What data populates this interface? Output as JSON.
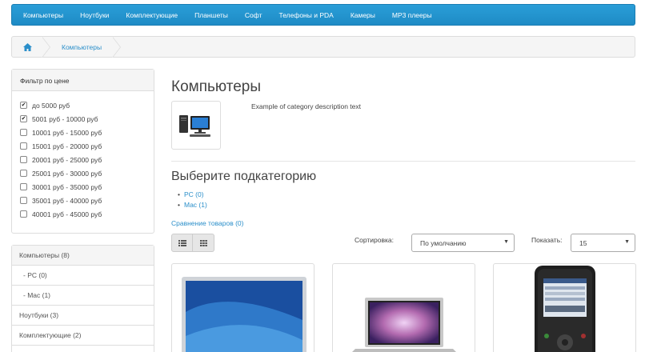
{
  "nav": {
    "items": [
      "Компьютеры",
      "Ноутбуки",
      "Комплектующие",
      "Планшеты",
      "Софт",
      "Телефоны и PDA",
      "Камеры",
      "MP3 плееры"
    ]
  },
  "breadcrumb": {
    "home_icon": "home-icon",
    "current": "Компьютеры"
  },
  "filter": {
    "title": "Фильтр по цене",
    "options": [
      {
        "label": "до 5000 руб",
        "checked": true
      },
      {
        "label": "5001 руб - 10000 руб",
        "checked": true
      },
      {
        "label": "10001 руб - 15000 руб",
        "checked": false
      },
      {
        "label": "15001 руб - 20000 руб",
        "checked": false
      },
      {
        "label": "20001 руб - 25000 руб",
        "checked": false
      },
      {
        "label": "25001 руб - 30000 руб",
        "checked": false
      },
      {
        "label": "30001 руб - 35000 руб",
        "checked": false
      },
      {
        "label": "35001 руб - 40000 руб",
        "checked": false
      },
      {
        "label": "40001 руб - 45000 руб",
        "checked": false
      }
    ]
  },
  "categories": [
    {
      "label": "Компьютеры (8)",
      "type": "head"
    },
    {
      "label": "- PC (0)",
      "type": "sub"
    },
    {
      "label": "- Mac (1)",
      "type": "sub"
    },
    {
      "label": "Ноутбуки (3)",
      "type": "item"
    },
    {
      "label": "Комплектующие (2)",
      "type": "item"
    }
  ],
  "main": {
    "title": "Компьютеры",
    "description": "Example of category description text",
    "subcategory_title": "Выберите подкатегорию",
    "subcategories": [
      "PC (0)",
      "Mac (1)"
    ],
    "compare_link": "Сравнение товаров (0)",
    "sort_label": "Сортировка:",
    "sort_value": "По умолчанию",
    "show_label": "Показать:",
    "show_value": "15"
  },
  "colors": {
    "accent": "#2b8fca",
    "nav": "#1e8bc5"
  }
}
